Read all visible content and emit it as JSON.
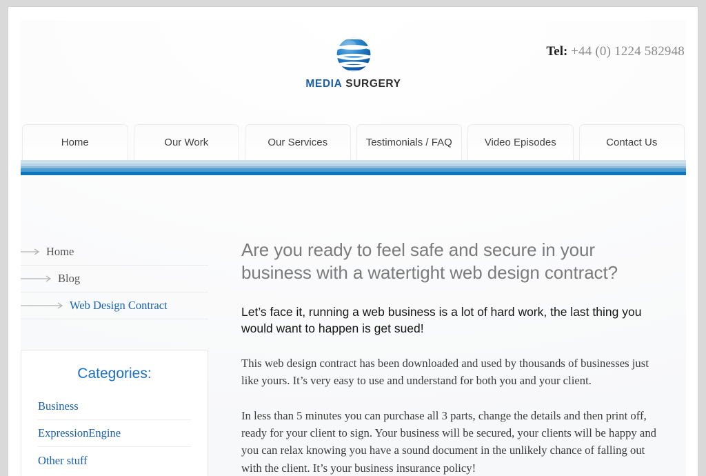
{
  "brand": {
    "logo_icon": "globe-icon",
    "word_primary": "MEDIA",
    "word_secondary": "SURGERY",
    "logo_color": "#1a5fa8"
  },
  "contact": {
    "label": "Tel:",
    "number": "+44 (0) 1224 582948"
  },
  "nav": {
    "items": [
      {
        "label": "Home"
      },
      {
        "label": "Our Work"
      },
      {
        "label": "Our Services"
      },
      {
        "label": "Testimonials / FAQ"
      },
      {
        "label": "Video Episodes"
      },
      {
        "label": "Contact Us"
      }
    ]
  },
  "accent_colors": {
    "stripe_1": "#cddfeb",
    "stripe_2": "#b9d4e6",
    "stripe_3": "#89bcdd",
    "stripe_4": "#4f9bd0",
    "stripe_5": "#0c74bd",
    "link": "#1a62ae"
  },
  "sidebar": {
    "breadcrumb": [
      {
        "label": "Home",
        "current": false
      },
      {
        "label": "Blog",
        "current": false
      },
      {
        "label": "Web Design Contract",
        "current": true
      }
    ],
    "categories": {
      "title": "Categories:",
      "items": [
        {
          "label": "Business"
        },
        {
          "label": "ExpressionEngine"
        },
        {
          "label": "Other stuff"
        }
      ]
    }
  },
  "article": {
    "headline": "Are you ready to feel safe and secure in your business with a watertight web design contract?",
    "lead": "Let’s face it, running a web business is a lot of hard work, the last thing you would want to happen is get sued!",
    "paragraphs": [
      "This web design contract has been downloaded and used by thousands of businesses just like yours. It’s very easy to use and understand for both you and your client.",
      "In less than 5 minutes you can purchase all 3 parts, change the details and then print off, ready for your client to sign. Your business will be secured, your clients will be happy and you can relax knowing you have a sound document in the unlikely chance of falling out with the client. It’s your business insurance policy!"
    ]
  }
}
